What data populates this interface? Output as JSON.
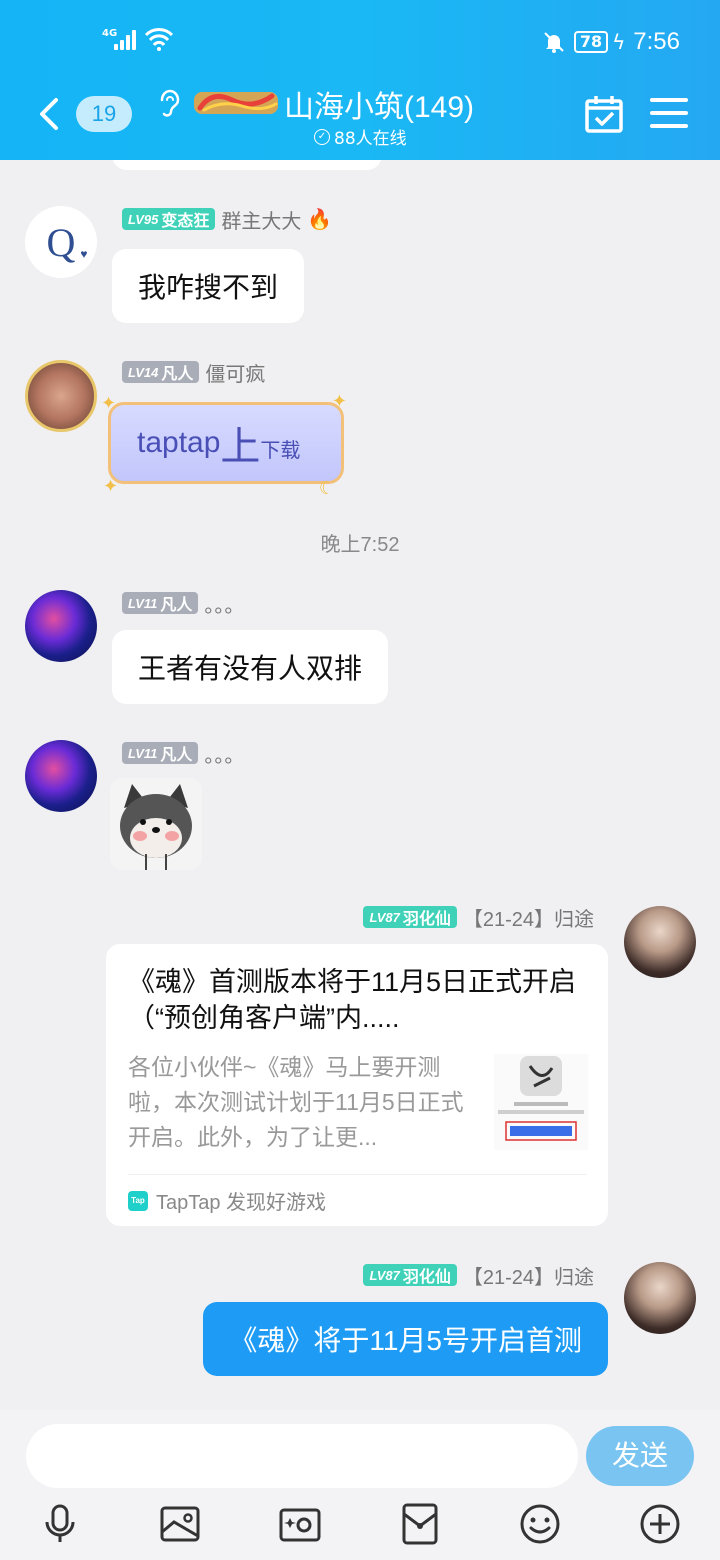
{
  "status_bar": {
    "network": "4G",
    "battery": "78",
    "time": "7:56"
  },
  "header": {
    "unread_count": "19",
    "group_name": "山海小筑(149)",
    "online_text": "88人在线"
  },
  "messages": [
    {
      "level": "LV95",
      "title": "变态狂",
      "nickname": "群主大大",
      "text": "我咋搜不到"
    },
    {
      "level": "LV14",
      "title": "凡人",
      "nickname": "僵可疯",
      "text_big": "taptap",
      "text_huge": "上",
      "text_small": "下载"
    },
    {
      "level": "LV11",
      "title": "凡人",
      "nickname": "。。。",
      "text": "王者有没有人双排"
    },
    {
      "level": "LV11",
      "title": "凡人",
      "nickname": "。。。"
    },
    {
      "level": "LV87",
      "title": "羽化仙",
      "nickname": "【21-24】归途"
    },
    {
      "level": "LV87",
      "title": "羽化仙",
      "nickname": "【21-24】归途",
      "text": "《魂》将于11月5号开启首测"
    }
  ],
  "timestamp": "晚上7:52",
  "share_card": {
    "title": "《魂》首测版本将于11月5日正式开启（“预创角客户端”内.....",
    "description": "各位小伙伴~《魂》马上要开测啦，本次测试计划于11月5日正式开启。此外，为了让更...",
    "source": "TapTap 发现好游戏"
  },
  "input_bar": {
    "placeholder": "",
    "send_label": "发送"
  },
  "colors": {
    "header": "#1ab8f4",
    "send_button": "#7ac4f1",
    "my_bubble": "#1e9cf5",
    "level_teal": "#3fd2b8",
    "level_gray": "#a9adb8"
  }
}
